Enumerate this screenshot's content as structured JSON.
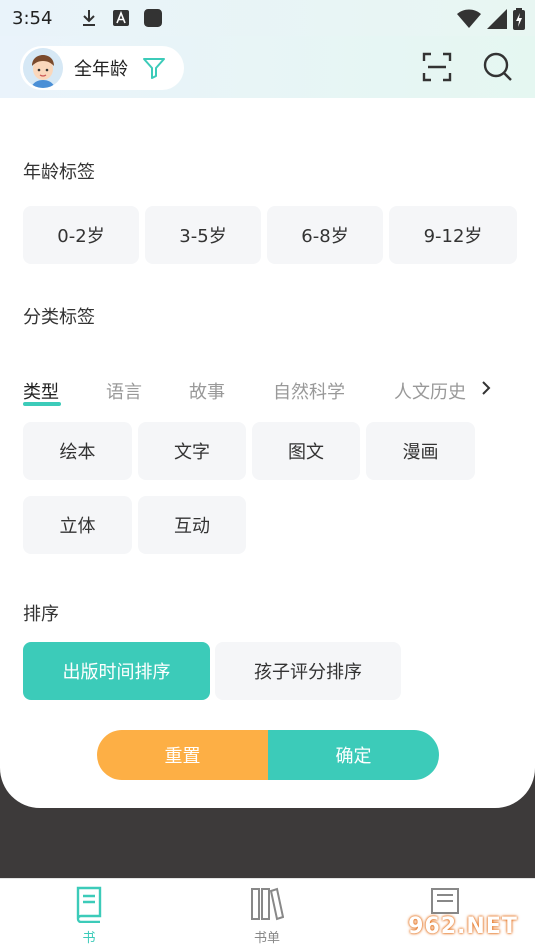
{
  "status_bar": {
    "time": "3:54",
    "icons": [
      "download-icon",
      "a-badge-icon",
      "app-square-icon",
      "wifi-icon",
      "signal-icon",
      "battery-icon"
    ]
  },
  "header": {
    "age_filter_label": "全年龄",
    "icons": [
      "avatar",
      "filter-icon",
      "scan-icon",
      "search-icon"
    ]
  },
  "age_section": {
    "title": "年龄标签",
    "chips": [
      "0-2岁",
      "3-5岁",
      "6-8岁",
      "9-12岁"
    ]
  },
  "category_section": {
    "title": "分类标签",
    "tabs": [
      "类型",
      "语言",
      "故事",
      "自然科学",
      "人文历史"
    ],
    "active_tab": "类型",
    "chips": [
      "绘本",
      "文字",
      "图文",
      "漫画",
      "立体",
      "互动"
    ]
  },
  "sort_section": {
    "title": "排序",
    "options": [
      "出版时间排序",
      "孩子评分排序"
    ],
    "active_option": "出版时间排序"
  },
  "actions": {
    "reset_label": "重置",
    "confirm_label": "确定"
  },
  "bottom_nav": {
    "items": [
      {
        "label": "书",
        "icon": "book-icon"
      },
      {
        "label": "书单",
        "icon": "bookshelf-icon"
      },
      {
        "label": "",
        "icon": "library-icon"
      }
    ],
    "active": "书"
  },
  "watermark": {
    "text": "962.NET"
  },
  "colors": {
    "accent": "#3ccbb9",
    "reset": "#fdaf45",
    "chip_bg": "#f5f6f8"
  }
}
